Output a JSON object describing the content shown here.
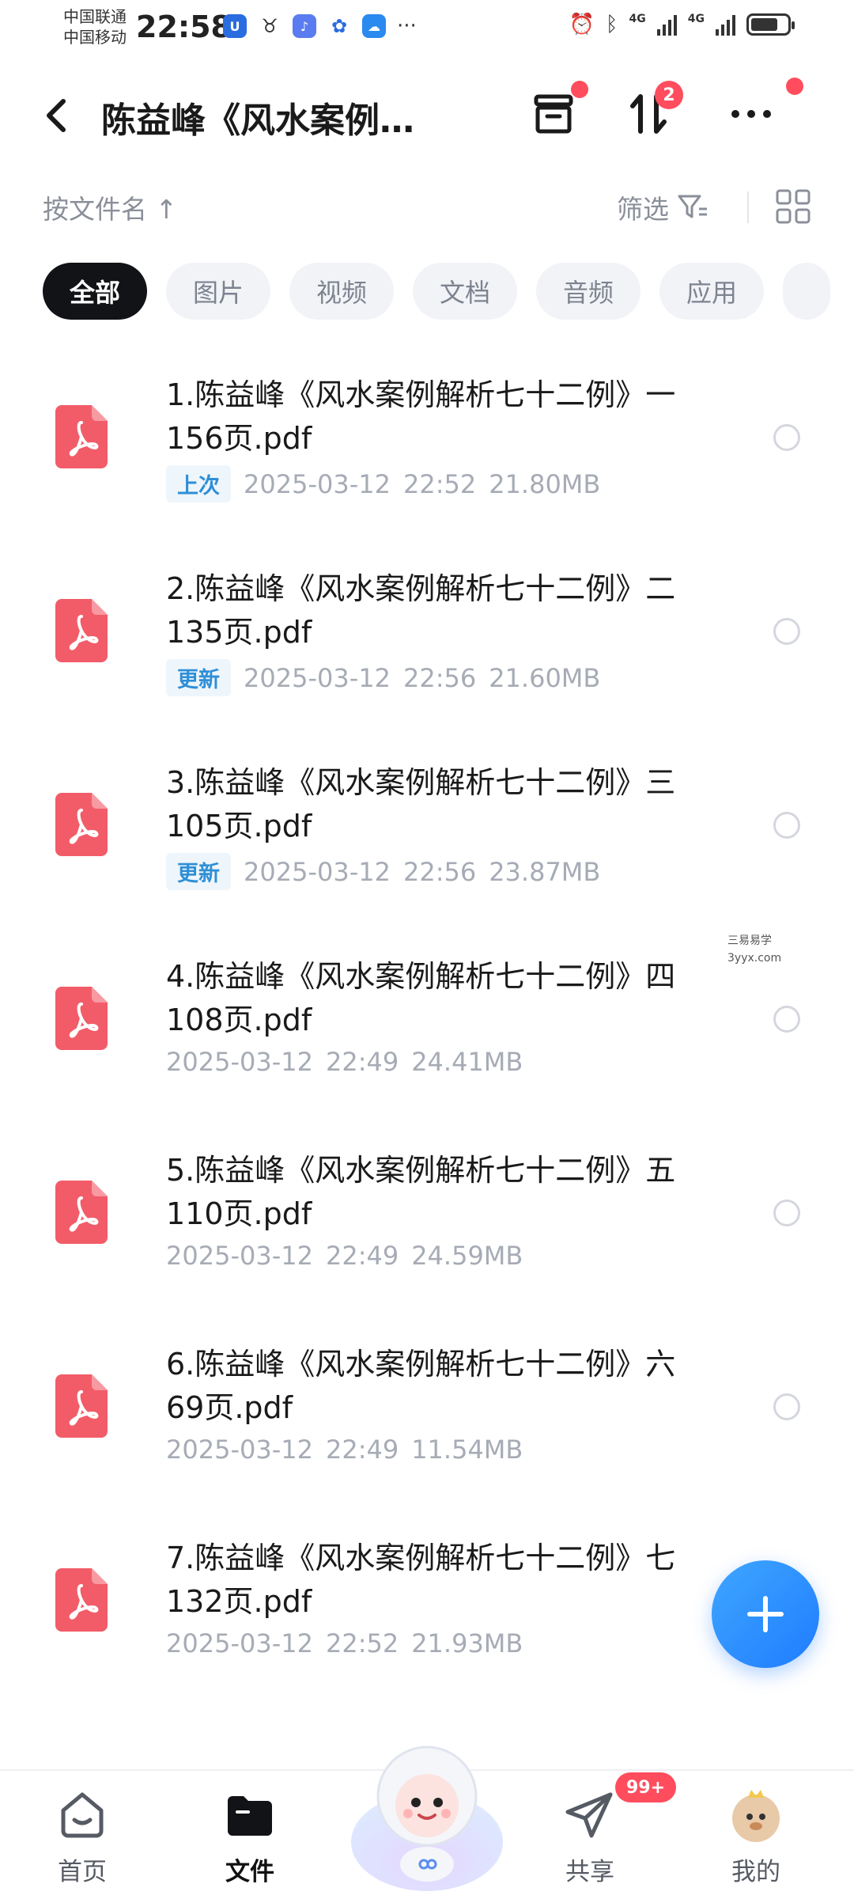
{
  "status_bar": {
    "carrier_1": "中国联通",
    "carrier_2": "中国移动",
    "time": "22:58",
    "dots": "···",
    "network_1": "4G",
    "network_2": "4G",
    "battery_level": 0.75
  },
  "header": {
    "title": "陈益峰《风水案例…",
    "transfer_badge": "2"
  },
  "sort_bar": {
    "sort_label": "按文件名 ↑",
    "filter_label": "筛选"
  },
  "chips": [
    {
      "label": "全部",
      "active": true
    },
    {
      "label": "图片",
      "active": false
    },
    {
      "label": "视频",
      "active": false
    },
    {
      "label": "文档",
      "active": false
    },
    {
      "label": "音频",
      "active": false
    },
    {
      "label": "应用",
      "active": false
    }
  ],
  "files": [
    {
      "name": "1.陈益峰《风水案例解析七十二例》一 156页.pdf",
      "tag": "上次",
      "date": "2025-03-12",
      "time": "22:52",
      "size": "21.80MB"
    },
    {
      "name": "2.陈益峰《风水案例解析七十二例》二 135页.pdf",
      "tag": "更新",
      "date": "2025-03-12",
      "time": "22:56",
      "size": "21.60MB"
    },
    {
      "name": "3.陈益峰《风水案例解析七十二例》三 105页.pdf",
      "tag": "更新",
      "date": "2025-03-12",
      "time": "22:56",
      "size": "23.87MB"
    },
    {
      "name": "4.陈益峰《风水案例解析七十二例》四 108页.pdf",
      "tag": "",
      "date": "2025-03-12",
      "time": "22:49",
      "size": "24.41MB"
    },
    {
      "name": "5.陈益峰《风水案例解析七十二例》五 110页.pdf",
      "tag": "",
      "date": "2025-03-12",
      "time": "22:49",
      "size": "24.59MB"
    },
    {
      "name": "6.陈益峰《风水案例解析七十二例》六 69页.pdf",
      "tag": "",
      "date": "2025-03-12",
      "time": "22:49",
      "size": "11.54MB"
    },
    {
      "name": "7.陈益峰《风水案例解析七十二例》七 132页.pdf",
      "tag": "",
      "date": "2025-03-12",
      "time": "22:52",
      "size": "21.93MB"
    }
  ],
  "watermark": {
    "line1": "三易易学",
    "line2": "3yyx.com"
  },
  "tab_bar": {
    "home": "首页",
    "files": "文件",
    "share": "共享",
    "share_badge": "99+",
    "mine": "我的"
  },
  "colors": {
    "accent": "#1f7cff",
    "pdf_red": "#f25c68",
    "badge_red": "#ff4d5e",
    "tag_blue": "#2f8fd6"
  }
}
